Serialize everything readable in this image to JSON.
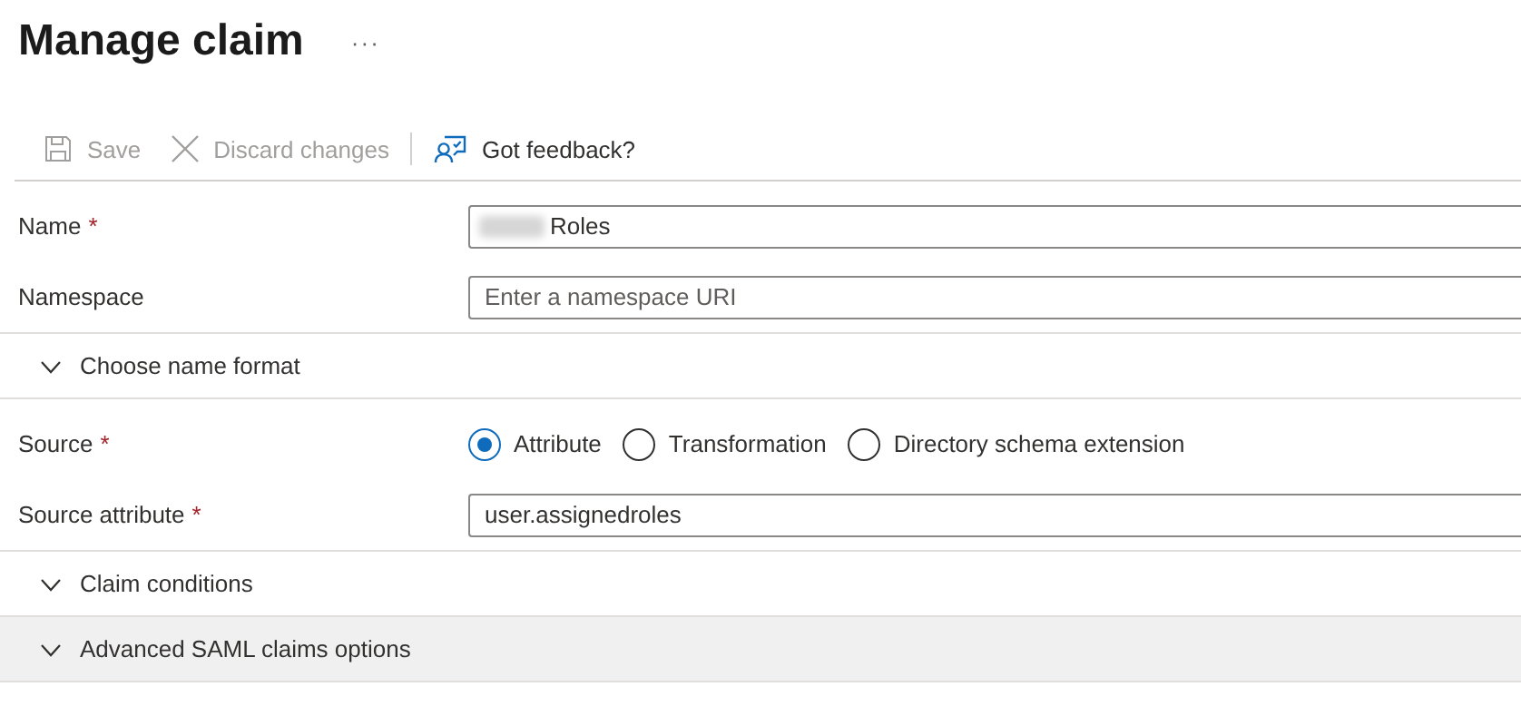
{
  "page": {
    "title": "Manage claim",
    "more": "···"
  },
  "toolbar": [
    {
      "kind": "save",
      "label": "Save",
      "disabled": true
    },
    {
      "kind": "discard",
      "label": "Discard changes",
      "disabled": true
    },
    {
      "kind": "feedback",
      "label": "Got feedback?",
      "disabled": false
    }
  ],
  "form": [
    {
      "kind": "text",
      "label": "Name",
      "required_mark": "*",
      "value": "Roles",
      "redacted": true
    },
    {
      "kind": "text",
      "label": "Namespace",
      "placeholder": "Enter a namespace URI"
    },
    {
      "kind": "section",
      "label": "Choose name format",
      "expanded": false,
      "highlighted": false
    },
    {
      "kind": "radio",
      "label": "Source",
      "required_mark": "*",
      "options": [
        {
          "label": "Attribute",
          "selected": true
        },
        {
          "label": "Transformation",
          "selected": false
        },
        {
          "label": "Directory schema extension",
          "selected": false
        }
      ]
    },
    {
      "kind": "text",
      "label": "Source attribute",
      "required_mark": "*",
      "value": "user.assignedroles"
    },
    {
      "kind": "section",
      "label": "Claim conditions",
      "expanded": false,
      "highlighted": false
    },
    {
      "kind": "section",
      "label": "Advanced SAML claims options",
      "expanded": false,
      "highlighted": true
    }
  ]
}
